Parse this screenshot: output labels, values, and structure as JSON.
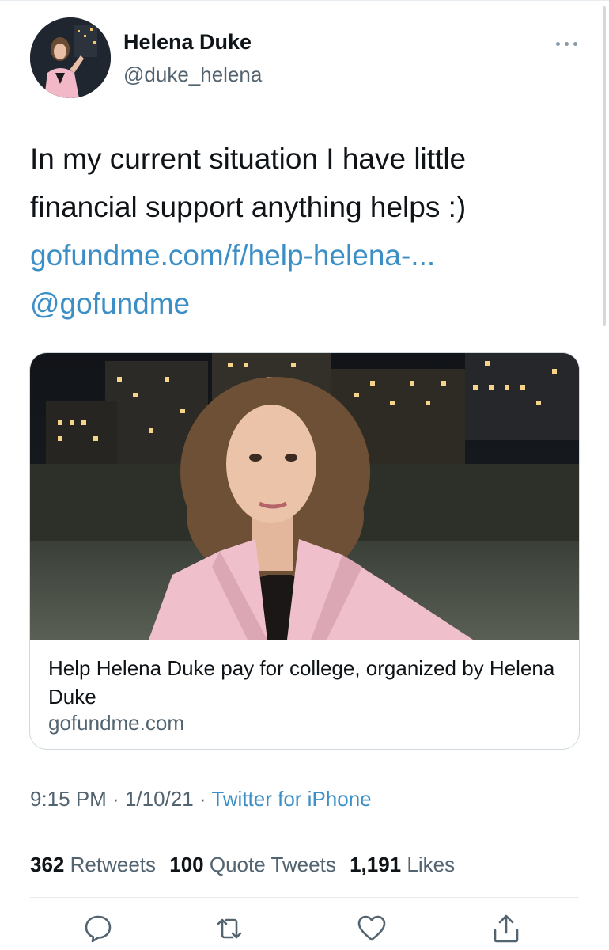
{
  "user": {
    "name": "Helena Duke",
    "handle": "@duke_helena"
  },
  "tweet": {
    "text_lines": [
      "In my current situation I have little",
      "financial support anything helps :)"
    ],
    "link": "gofundme.com/f/help-helena-...",
    "mention": "@gofundme"
  },
  "card": {
    "title": "Help Helena Duke pay for college, organized by Helena Duke",
    "domain": "gofundme.com"
  },
  "meta": {
    "time": "9:15 PM",
    "separator": " · ",
    "date": "1/10/21",
    "source": "Twitter for iPhone"
  },
  "stats": {
    "retweets_count": "362",
    "retweets_label": "Retweets",
    "quotes_count": "100",
    "quotes_label": "Quote Tweets",
    "likes_count": "1,191",
    "likes_label": "Likes"
  },
  "icons": {
    "reply": "reply-icon",
    "retweet": "retweet-icon",
    "like": "like-icon",
    "share": "share-icon",
    "more": "more-icon"
  },
  "colors": {
    "link": "#3c8fc6",
    "secondary_text": "#536471",
    "primary_text": "#0f1419",
    "border": "#cfd9de"
  }
}
